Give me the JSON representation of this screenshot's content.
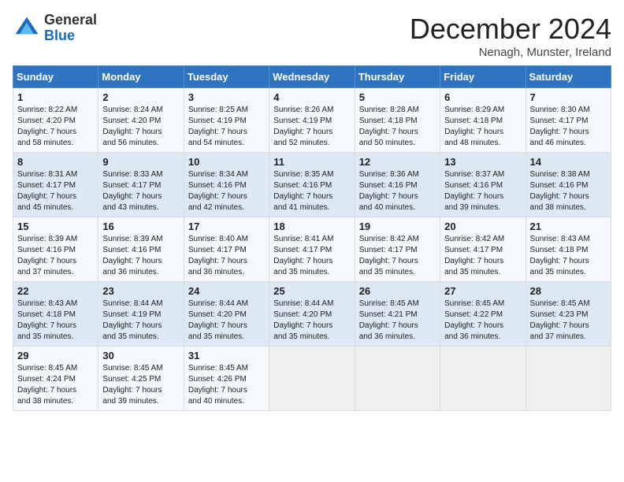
{
  "logo": {
    "general": "General",
    "blue": "Blue"
  },
  "title": "December 2024",
  "subtitle": "Nenagh, Munster, Ireland",
  "days_of_week": [
    "Sunday",
    "Monday",
    "Tuesday",
    "Wednesday",
    "Thursday",
    "Friday",
    "Saturday"
  ],
  "weeks": [
    [
      {
        "day": "1",
        "info": "Sunrise: 8:22 AM\nSunset: 4:20 PM\nDaylight: 7 hours\nand 58 minutes."
      },
      {
        "day": "2",
        "info": "Sunrise: 8:24 AM\nSunset: 4:20 PM\nDaylight: 7 hours\nand 56 minutes."
      },
      {
        "day": "3",
        "info": "Sunrise: 8:25 AM\nSunset: 4:19 PM\nDaylight: 7 hours\nand 54 minutes."
      },
      {
        "day": "4",
        "info": "Sunrise: 8:26 AM\nSunset: 4:19 PM\nDaylight: 7 hours\nand 52 minutes."
      },
      {
        "day": "5",
        "info": "Sunrise: 8:28 AM\nSunset: 4:18 PM\nDaylight: 7 hours\nand 50 minutes."
      },
      {
        "day": "6",
        "info": "Sunrise: 8:29 AM\nSunset: 4:18 PM\nDaylight: 7 hours\nand 48 minutes."
      },
      {
        "day": "7",
        "info": "Sunrise: 8:30 AM\nSunset: 4:17 PM\nDaylight: 7 hours\nand 46 minutes."
      }
    ],
    [
      {
        "day": "8",
        "info": "Sunrise: 8:31 AM\nSunset: 4:17 PM\nDaylight: 7 hours\nand 45 minutes."
      },
      {
        "day": "9",
        "info": "Sunrise: 8:33 AM\nSunset: 4:17 PM\nDaylight: 7 hours\nand 43 minutes."
      },
      {
        "day": "10",
        "info": "Sunrise: 8:34 AM\nSunset: 4:16 PM\nDaylight: 7 hours\nand 42 minutes."
      },
      {
        "day": "11",
        "info": "Sunrise: 8:35 AM\nSunset: 4:16 PM\nDaylight: 7 hours\nand 41 minutes."
      },
      {
        "day": "12",
        "info": "Sunrise: 8:36 AM\nSunset: 4:16 PM\nDaylight: 7 hours\nand 40 minutes."
      },
      {
        "day": "13",
        "info": "Sunrise: 8:37 AM\nSunset: 4:16 PM\nDaylight: 7 hours\nand 39 minutes."
      },
      {
        "day": "14",
        "info": "Sunrise: 8:38 AM\nSunset: 4:16 PM\nDaylight: 7 hours\nand 38 minutes."
      }
    ],
    [
      {
        "day": "15",
        "info": "Sunrise: 8:39 AM\nSunset: 4:16 PM\nDaylight: 7 hours\nand 37 minutes."
      },
      {
        "day": "16",
        "info": "Sunrise: 8:39 AM\nSunset: 4:16 PM\nDaylight: 7 hours\nand 36 minutes."
      },
      {
        "day": "17",
        "info": "Sunrise: 8:40 AM\nSunset: 4:17 PM\nDaylight: 7 hours\nand 36 minutes."
      },
      {
        "day": "18",
        "info": "Sunrise: 8:41 AM\nSunset: 4:17 PM\nDaylight: 7 hours\nand 35 minutes."
      },
      {
        "day": "19",
        "info": "Sunrise: 8:42 AM\nSunset: 4:17 PM\nDaylight: 7 hours\nand 35 minutes."
      },
      {
        "day": "20",
        "info": "Sunrise: 8:42 AM\nSunset: 4:17 PM\nDaylight: 7 hours\nand 35 minutes."
      },
      {
        "day": "21",
        "info": "Sunrise: 8:43 AM\nSunset: 4:18 PM\nDaylight: 7 hours\nand 35 minutes."
      }
    ],
    [
      {
        "day": "22",
        "info": "Sunrise: 8:43 AM\nSunset: 4:18 PM\nDaylight: 7 hours\nand 35 minutes."
      },
      {
        "day": "23",
        "info": "Sunrise: 8:44 AM\nSunset: 4:19 PM\nDaylight: 7 hours\nand 35 minutes."
      },
      {
        "day": "24",
        "info": "Sunrise: 8:44 AM\nSunset: 4:20 PM\nDaylight: 7 hours\nand 35 minutes."
      },
      {
        "day": "25",
        "info": "Sunrise: 8:44 AM\nSunset: 4:20 PM\nDaylight: 7 hours\nand 35 minutes."
      },
      {
        "day": "26",
        "info": "Sunrise: 8:45 AM\nSunset: 4:21 PM\nDaylight: 7 hours\nand 36 minutes."
      },
      {
        "day": "27",
        "info": "Sunrise: 8:45 AM\nSunset: 4:22 PM\nDaylight: 7 hours\nand 36 minutes."
      },
      {
        "day": "28",
        "info": "Sunrise: 8:45 AM\nSunset: 4:23 PM\nDaylight: 7 hours\nand 37 minutes."
      }
    ],
    [
      {
        "day": "29",
        "info": "Sunrise: 8:45 AM\nSunset: 4:24 PM\nDaylight: 7 hours\nand 38 minutes."
      },
      {
        "day": "30",
        "info": "Sunrise: 8:45 AM\nSunset: 4:25 PM\nDaylight: 7 hours\nand 39 minutes."
      },
      {
        "day": "31",
        "info": "Sunrise: 8:45 AM\nSunset: 4:26 PM\nDaylight: 7 hours\nand 40 minutes."
      },
      {
        "day": "",
        "info": ""
      },
      {
        "day": "",
        "info": ""
      },
      {
        "day": "",
        "info": ""
      },
      {
        "day": "",
        "info": ""
      }
    ]
  ]
}
